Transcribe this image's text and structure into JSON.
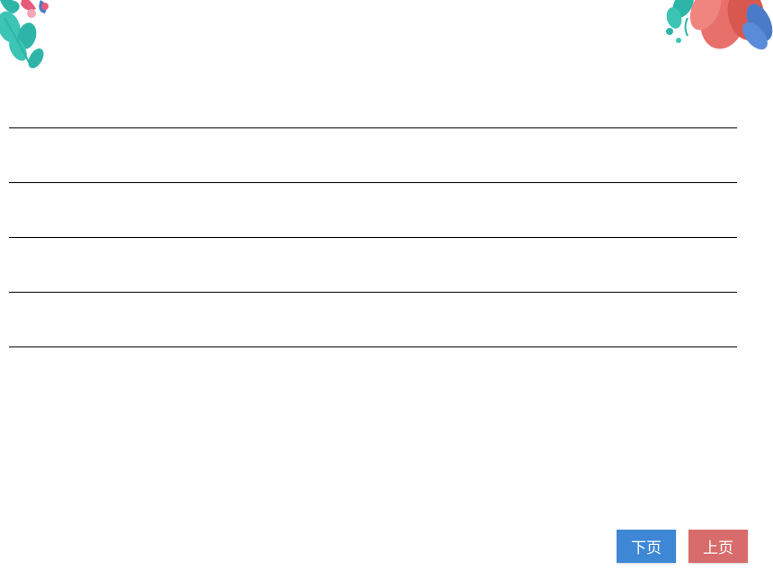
{
  "navigation": {
    "next_label": "下页",
    "prev_label": "上页"
  },
  "decorations": {
    "top_left": "floral-leaves-left",
    "top_right": "floral-leaves-right"
  },
  "colors": {
    "next_button": "#3d87d4",
    "prev_button": "#d86b6b"
  }
}
